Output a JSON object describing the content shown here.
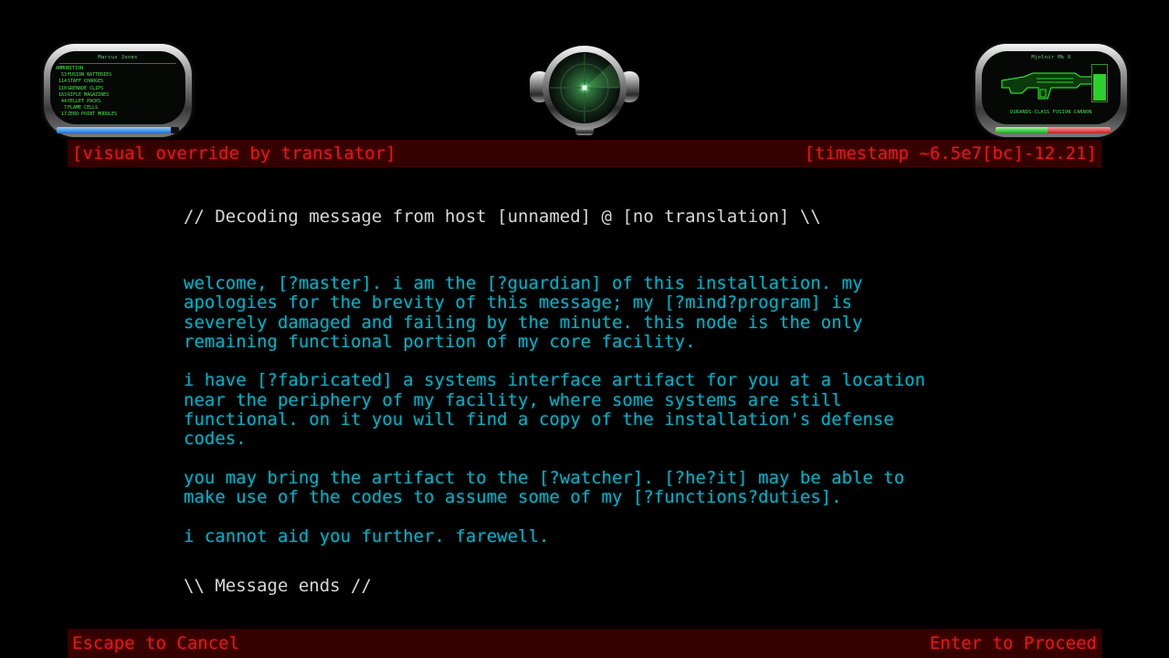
{
  "ammo_panel": {
    "player_name": "Marcus Jones",
    "heading": "AMMUNITION",
    "items": [
      {
        "qty": "53",
        "name": "FUSION BATTERIES"
      },
      {
        "qty": "114",
        "name": "STAFF CHARGES"
      },
      {
        "qty": "110",
        "name": "GRENADE CLIPS"
      },
      {
        "qty": "163",
        "name": "RIFLE MAGAZINES"
      },
      {
        "qty": "44",
        "name": "PELLET PACKS"
      },
      {
        "qty": "7",
        "name": "FLAME CELLS"
      },
      {
        "qty": "17",
        "name": "ZERO-POINT MODULES"
      }
    ],
    "shield_level": 0.93
  },
  "weapon_panel": {
    "title": "Mjolnir Mk X",
    "weapon_name": "DURANDS-CLASS FUSION CANNON",
    "charge_level": 0.78,
    "energy_level": 0.45,
    "color_accent": "#2ecf2e"
  },
  "radar": {
    "icon": "motion-sensor-icon"
  },
  "banner_top": {
    "left": "[visual override by translator]",
    "right": "[timestamp ~6.5e7[bc]-12.21]"
  },
  "message": {
    "header": "// Decoding message from host [unnamed] @ [no translation] \\\\",
    "paragraphs": [
      "welcome, [?master]. i am the [?guardian] of this installation. my\napologies for the brevity of this message; my [?mind?program] is\nseverely damaged and failing by the minute. this node is the only\nremaining functional portion of my core facility.",
      "i have [?fabricated] a systems interface artifact for you at a location\nnear the periphery of my facility, where some systems are still\nfunctional. on it you will find a copy of the installation's defense\ncodes.",
      "you may bring the artifact to the [?watcher]. [?he?it] may be able to\nmake use of the codes to assume some of my [?functions?duties].",
      "i cannot aid you further. farewell."
    ],
    "footer": "\\\\ Message ends //"
  },
  "controls": {
    "cancel": "Escape to Cancel",
    "proceed": "Enter to Proceed"
  },
  "colors": {
    "banner_text": "#d41e1e",
    "message_text": "#1aa8bd",
    "hud_green": "#54e454"
  }
}
